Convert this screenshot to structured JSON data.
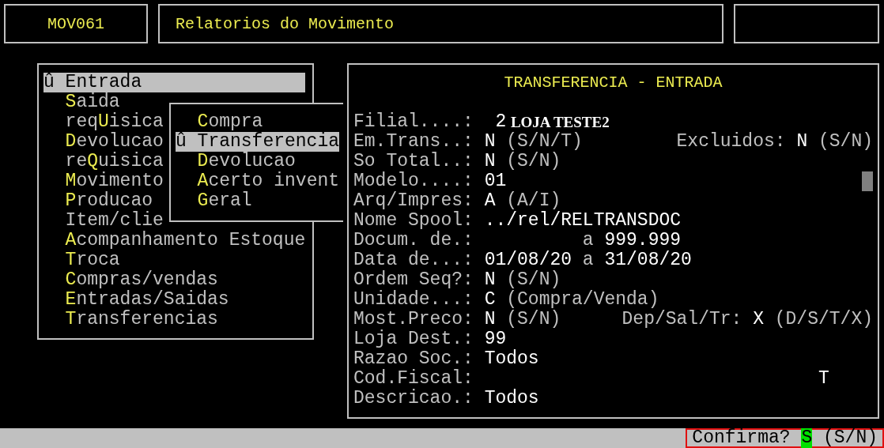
{
  "header": {
    "code": "MOV061",
    "title": "Relatorios do Movimento"
  },
  "menu": {
    "items": [
      {
        "marker": "û",
        "before": "Entrada",
        "selected": true
      },
      {
        "key": "S",
        "after": "aida",
        "selected": false
      },
      {
        "before": "req",
        "key": "U",
        "after": "isica",
        "selected": false
      },
      {
        "key": "D",
        "after": "evolucao",
        "selected": false
      },
      {
        "before": "re",
        "key": "Q",
        "after": "uisica",
        "selected": false
      },
      {
        "key": "M",
        "after": "ovimento",
        "selected": false
      },
      {
        "key": "P",
        "after": "roducao",
        "selected": false
      },
      {
        "before": "Item/clie",
        "selected": false
      },
      {
        "key": "A",
        "after": "companhamento Estoque",
        "selected": false
      },
      {
        "key": "T",
        "after": "roca",
        "selected": false
      },
      {
        "key": "C",
        "after": "ompras/vendas",
        "selected": false
      },
      {
        "key": "E",
        "after": "ntradas/Saidas",
        "selected": false
      },
      {
        "key": "T",
        "after": "ransferencias",
        "selected": false
      }
    ]
  },
  "submenu": {
    "items": [
      {
        "key": "C",
        "after": "ompra",
        "selected": false
      },
      {
        "marker": "û",
        "before": "Transferencia",
        "selected": true
      },
      {
        "key": "D",
        "after": "evolucao",
        "selected": false
      },
      {
        "key": "A",
        "after": "certo invent",
        "selected": false
      },
      {
        "key": "G",
        "after": "eral",
        "selected": false
      }
    ]
  },
  "form": {
    "title": "TRANSFERENCIA - ENTRADA",
    "fields": [
      {
        "kind": "store",
        "label": "Filial....:",
        "value": "2",
        "name": "LOJA TESTE2"
      },
      {
        "kind": "flag",
        "label": "Em.Trans..:",
        "value": "N",
        "hint": "(S/N/T)",
        "extra": {
          "label": "Excluidos:",
          "value": "N",
          "hint": "(S/N)"
        }
      },
      {
        "kind": "flag",
        "label": "So Total..:",
        "value": "N",
        "hint": "(S/N)"
      },
      {
        "kind": "flag",
        "label": "Modelo....:",
        "value": "01"
      },
      {
        "kind": "flag",
        "label": "Arq/Impres:",
        "value": "A",
        "hint": "(A/I)"
      },
      {
        "kind": "flag",
        "label": "Nome Spool:",
        "value": "../rel/RELTRANSDOC"
      },
      {
        "kind": "range",
        "label": "Docum. de.:",
        "separator": "a",
        "to": "999.999"
      },
      {
        "kind": "range",
        "label": "Data de...:",
        "from": "01/08/20",
        "separator": "a",
        "to": "31/08/20"
      },
      {
        "kind": "flag",
        "label": "Ordem Seq?:",
        "value": "N",
        "hint": "(S/N)"
      },
      {
        "kind": "flag",
        "label": "Unidade...:",
        "value": "C",
        "hint": "(Compra/Venda)"
      },
      {
        "kind": "flag",
        "label": "Most.Preco:",
        "value": "N",
        "hint": "(S/N)",
        "extra": {
          "label": "Dep/Sal/Tr:",
          "value": "X",
          "hint": "(D/S/T/X)"
        }
      },
      {
        "kind": "flag",
        "label": "Loja Dest.:",
        "value": "99"
      },
      {
        "kind": "flag",
        "label": "Razao Soc.:",
        "value": "Todos"
      },
      {
        "kind": "flag",
        "label": "Cod.Fiscal:",
        "mark": "T"
      },
      {
        "kind": "flag",
        "label": "Descricao.:",
        "value": "Todos"
      }
    ]
  },
  "status_bar": {
    "prompt": "Confirma?",
    "answer": "S",
    "hint": "(S/N)"
  }
}
